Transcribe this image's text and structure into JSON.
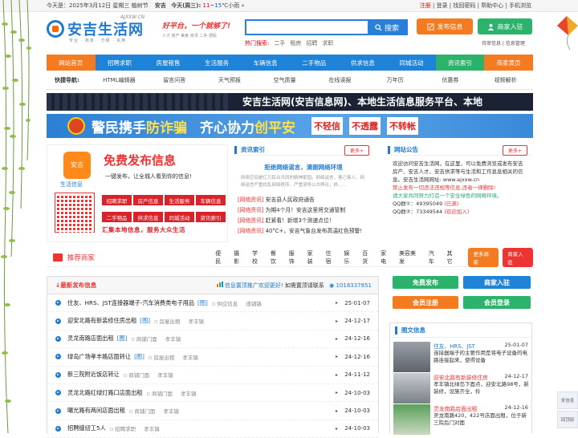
{
  "topbar": {
    "weather_label": "今天是：2025年3月12日 星期三 植树节",
    "city": "安吉",
    "today": "今天(周三):",
    "temp_low": "11",
    "temp_sep": "~",
    "temp_high": "15",
    "temp_unit": "℃小雨",
    "arrow": "»",
    "links": [
      "注册",
      "登录",
      "找回密码",
      "帮助中心",
      "手机浏览"
    ]
  },
  "logo": {
    "domain": "AJXXW.CN",
    "name": "安吉生活网",
    "tagline": "专业 · 简单 · 方便 · 实用"
  },
  "slogan": {
    "line1": "好平台，一个就够了!",
    "line2": "人才 房产 美食 资讯 二手 便民"
  },
  "search": {
    "placeholder": "",
    "button": "搜索",
    "hot_label": "热门搜索:",
    "hot": [
      "二手",
      "租房",
      "招聘",
      "求职"
    ]
  },
  "publish": {
    "btn1": "发布信息",
    "btn2": "商家入驻",
    "sub": "待审信息 | 信息管理"
  },
  "nav": [
    "网站首页",
    "招聘求职",
    "房屋租售",
    "生活服务",
    "车辆信息",
    "二手物品",
    "供求信息",
    "同城活动",
    "资讯索引",
    "商家黄页"
  ],
  "quick": {
    "label": "快捷导航:",
    "items": [
      "HTML编辑器",
      "留言问答",
      "天气预报",
      "空气质量",
      "在线读报",
      "万年历",
      "优惠券",
      "视频解析"
    ]
  },
  "banner1": "安吉生活网(安吉信息网)、本地生活信息服务平台、本地",
  "banner2": {
    "w1a": "警民携手",
    "w1b": "防诈骗",
    "w2a": "齐心协力",
    "w2b": "创平安",
    "no": [
      "不轻信",
      "不透露",
      "不转帐"
    ]
  },
  "freead": {
    "logo": "安吉",
    "logo_sub": "生活信息",
    "big": "免费发布信息",
    "small": "一键发布，让全城人看到你的信息!",
    "cats": [
      "招聘求职",
      "房产信息",
      "生活服务",
      "车辆信息",
      "二手物品",
      "供求信息",
      "同城活动",
      "资讯索引"
    ],
    "foot": "汇集本地信息，服务大众生活"
  },
  "news": {
    "title": "资讯索引",
    "more": "更多+",
    "head": "拒绝网络谣言，清朗网络环境",
    "desc": "网络空间是亿万民众共同的精神家园。网络谣言，害己害人。网络谣言严重扰乱网络秩序，严重误导公共舆论，损……",
    "items": [
      {
        "tag": "[网络资讯]",
        "text": "安吉县人民政府通告"
      },
      {
        "tag": "[网络资讯]",
        "text": "为期4个月！安吉这里将交通管制"
      },
      {
        "tag": "[网络资讯]",
        "text": "赶紧看！新增3个测速点位！"
      },
      {
        "tag": "[网络资讯]",
        "text": "40°C+，安吉气象台发布高温红色预警!"
      }
    ]
  },
  "notice": {
    "title": "网站公告",
    "more": "更多+",
    "text1": "欢迎访问安吉生活网，在这里，可以免费浏览或发布安吉房产、安吉人才、安吉供求等与生活和工作息息相关的信息。安吉生活网网址: www.ajxxw.cn",
    "text2": "禁止发布一切违法违规等信息,违者一律删除!",
    "text3": "请大家共同努力打造一个安全绿色的网络环境。",
    "qq1_label": "QQ群①：",
    "qq1": "49395049",
    "qq1_state": "(已满)",
    "qq2_label": "QQ群②：",
    "qq2": "73349544",
    "qq2_state": "(欢迎加入)"
  },
  "merchants": {
    "title": "推荐商家",
    "cats": [
      "便民",
      "摄影",
      "学校",
      "餐饮",
      "服饰",
      "家装",
      "住宿",
      "娱乐",
      "百货",
      "家电",
      "美容美发",
      "汽车",
      "其它"
    ],
    "more": "更多商家",
    "join": "商家入驻"
  },
  "latest": {
    "title": "↓最新发布信息",
    "promo": "信息置顶推广欢迎更好!",
    "contact": "如需置顶请联系",
    "tel": "1018337851",
    "rows": [
      {
        "title": "住友、HRS、JST连接器端子-汽车消费类电子用品",
        "img": "[图]",
        "cat": "供应信息",
        "area": "递铺镇",
        "date": "25-01-07"
      },
      {
        "title": "迎安北路有新装修住房出租",
        "img": "[图]",
        "cat": "房屋出租",
        "area": "孝丰镇",
        "date": "24-12-17"
      },
      {
        "title": "灵龙南路店面出租",
        "img": "[图]",
        "cat": "商铺门面",
        "area": "孝丰镇",
        "date": "24-12-16"
      },
      {
        "title": "绿岛广场孝丰路店面转让",
        "img": "[图]",
        "cat": "房屋出租",
        "area": "孝丰镇",
        "date": "24-12-16"
      },
      {
        "title": "新三院附近饭店转让",
        "img": "",
        "cat": "商铺门面",
        "area": "孝丰镇",
        "date": "24-11-12"
      },
      {
        "title": "灵龙北路红绿灯路口店面出租",
        "img": "",
        "cat": "商铺门面",
        "area": "孝丰镇",
        "date": "24-10-03"
      },
      {
        "title": "曙光路有两间店面出租",
        "img": "",
        "cat": "商铺门面",
        "area": "孝丰镇",
        "date": "24-10-03"
      },
      {
        "title": "招聘缝纫工5人",
        "img": "",
        "cat": "招聘求职",
        "area": "孝丰镇",
        "date": "24-10-03"
      }
    ]
  },
  "side": {
    "b1": "免费发布",
    "b2": "商家入驻",
    "b3": "会员注册",
    "b4": "会员登录"
  },
  "pics": {
    "title": "图文信息",
    "items": [
      {
        "title": "住友、HRS、JST",
        "date": "25-01-07",
        "desc": "连接器端子的主要作用是将电子设备的电路连接起来，使得设备"
      },
      {
        "title": "迎安北路有新装修住房",
        "date": "24-12-17",
        "desc": "孝丰镇北绿岛下面点，迎安北路98号，新装修，设施齐全，拎"
      },
      {
        "title": "灵龙南路店面出租",
        "date": "24-12-16",
        "desc": "灵龙南路420，422号店面出租，位于新三院后门对面"
      }
    ]
  },
  "float": {
    "f1": "发信息",
    "f2": "回顶部"
  },
  "colors": {
    "accent": "#1f83d8",
    "orange": "#f47b20",
    "green": "#2bb26b",
    "red": "#e33"
  }
}
